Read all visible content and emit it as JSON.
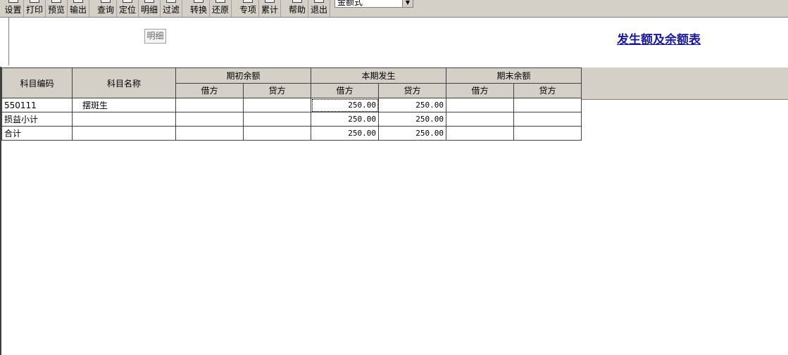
{
  "toolbar": {
    "buttons": [
      {
        "id": "setup",
        "label": "设置",
        "icon": "settings-icon"
      },
      {
        "id": "print",
        "label": "打印",
        "icon": "printer-icon"
      },
      {
        "id": "preview",
        "label": "预览",
        "icon": "preview-icon"
      },
      {
        "id": "export",
        "label": "输出",
        "icon": "export-icon"
      },
      {
        "id": "query",
        "label": "查询",
        "icon": "query-icon"
      },
      {
        "id": "locate",
        "label": "定位",
        "icon": "locate-icon"
      },
      {
        "id": "detail",
        "label": "明细",
        "icon": "detail-icon"
      },
      {
        "id": "filter",
        "label": "过滤",
        "icon": "filter-icon"
      },
      {
        "id": "convert",
        "label": "转换",
        "icon": "convert-icon"
      },
      {
        "id": "restore",
        "label": "还原",
        "icon": "restore-icon"
      },
      {
        "id": "special",
        "label": "专项",
        "icon": "special-icon"
      },
      {
        "id": "cumulative",
        "label": "累计",
        "icon": "cumulative-icon"
      },
      {
        "id": "help",
        "label": "帮助",
        "icon": "help-icon"
      },
      {
        "id": "exit",
        "label": "退出",
        "icon": "exit-icon"
      }
    ],
    "format_select": "金额式"
  },
  "detail_label": "明细",
  "report_title": "发生额及余额表",
  "table": {
    "headers": {
      "code": "科目编码",
      "name": "科目名称",
      "opening": "期初余额",
      "current": "本期发生",
      "closing": "期末余额",
      "debit": "借方",
      "credit": "贷方"
    },
    "rows": [
      {
        "code": "550111",
        "name": "摆斑生",
        "open_debit": "",
        "open_credit": "",
        "cur_debit": "250.00",
        "cur_credit": "250.00",
        "close_debit": "",
        "close_credit": ""
      },
      {
        "code": "损益小计",
        "name": "",
        "open_debit": "",
        "open_credit": "",
        "cur_debit": "250.00",
        "cur_credit": "250.00",
        "close_debit": "",
        "close_credit": ""
      },
      {
        "code": "合计",
        "name": "",
        "open_debit": "",
        "open_credit": "",
        "cur_debit": "250.00",
        "cur_credit": "250.00",
        "close_debit": "",
        "close_credit": ""
      }
    ]
  }
}
